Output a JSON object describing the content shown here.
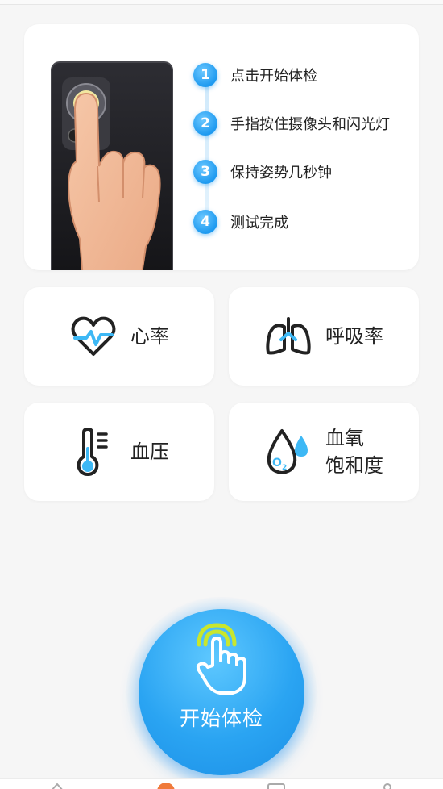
{
  "guide": {
    "steps": [
      {
        "num": "1",
        "text": "点击开始体检"
      },
      {
        "num": "2",
        "text": "手指按住摄像头和闪光灯"
      },
      {
        "num": "3",
        "text": "保持姿势几秒钟"
      },
      {
        "num": "4",
        "text": "测试完成"
      }
    ]
  },
  "metrics": [
    {
      "label": "心率",
      "icon": "heart-rate-icon"
    },
    {
      "label": "呼吸率",
      "icon": "lungs-icon"
    },
    {
      "label": "血压",
      "icon": "thermometer-icon"
    },
    {
      "label_line1": "血氧",
      "label_line2": "饱和度",
      "icon": "oxygen-drop-icon"
    }
  ],
  "start_button": {
    "label": "开始体检",
    "icon": "finger-tap-icon"
  },
  "colors": {
    "accent": "#2aa4f2",
    "icon_dark": "#222222",
    "icon_blue": "#3db8f5",
    "tap_green": "#c8e62e",
    "active_tab": "#f07a3a"
  },
  "tabbar": {
    "icons": [
      "home-icon",
      "check-icon",
      "message-icon",
      "profile-icon"
    ]
  }
}
